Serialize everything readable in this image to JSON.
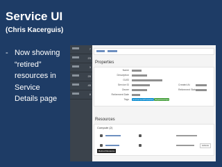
{
  "slide": {
    "title": "Service UI",
    "subtitle": "(Chris Kacerguis)",
    "bullet_dash": "-",
    "bullet_lines": [
      "Now showing",
      "“retired”",
      "resources in",
      "Service",
      "Details page"
    ]
  },
  "screenshot": {
    "sidebar_counts": [
      "7",
      "23",
      "3",
      "20",
      "45",
      "8"
    ],
    "sections": {
      "properties": "Properties",
      "resources": "Resources"
    },
    "properties": {
      "labels": [
        "Name",
        "Description",
        "GUID",
        "Service ID",
        "Owner",
        "Retirement Date",
        "Tags"
      ],
      "right_labels": [
        "Created At",
        "Retirement State"
      ],
      "tags": [
        "/environment/Production",
        "/department/ops"
      ]
    },
    "resources": {
      "group_label": "Compute (2)",
      "tooltip": "Retired Resource",
      "action_label": "Actions"
    },
    "colors": {
      "sidebar": "#3b434c",
      "tag_primary": "#0088ce",
      "tag_secondary": "#3f9c35"
    }
  }
}
